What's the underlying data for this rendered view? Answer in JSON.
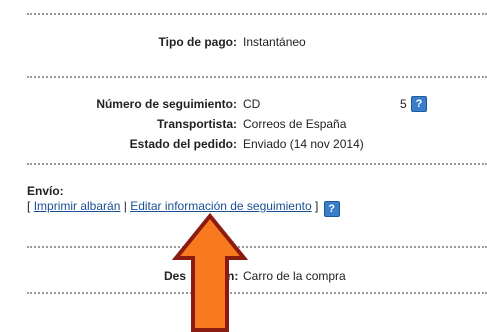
{
  "pago": {
    "label": "Tipo de pago:",
    "value": "Instantáneo"
  },
  "seguimiento": {
    "label": "Número de seguimiento:",
    "value_start": "CD​",
    "value_end": "5",
    "help_glyph": "?"
  },
  "transportista": {
    "label": "Transportista:",
    "value": "Correos de España"
  },
  "estado": {
    "label": "Estado del pedido:",
    "value": "Enviado (14 nov 2014)"
  },
  "envio": {
    "title": "Envío:",
    "open_bracket": "[",
    "separator": "|",
    "close_bracket": "]",
    "print_link": "Imprimir albarán",
    "edit_link": "Editar información de seguimiento",
    "help_glyph": "?"
  },
  "descripcion": {
    "label": "Des",
    "label_end": "n:",
    "value": "Carro de la compra"
  },
  "colors": {
    "help_icon": "#3a7dc9",
    "link": "#1a4f94",
    "arrow_fill": "#f97a1e",
    "arrow_stroke": "#8b1a10"
  },
  "icons": {
    "help": "help-icon",
    "pointer": "up-arrow-annotation"
  }
}
